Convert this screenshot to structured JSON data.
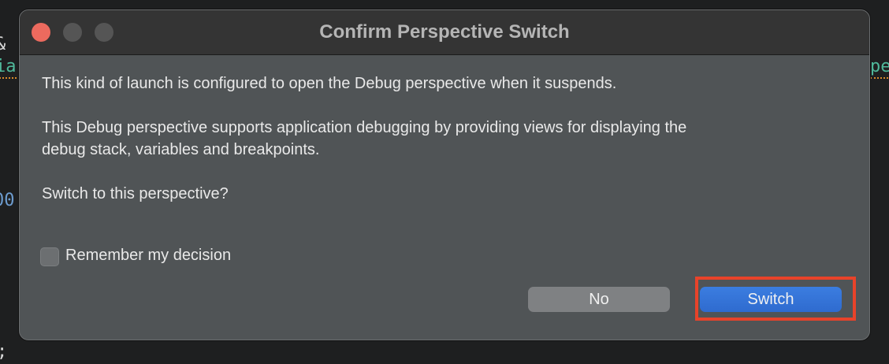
{
  "background_code": {
    "frag1": "&",
    "frag2": "ia",
    "frag3": "00",
    "frag4": ";",
    "frag5": "pe"
  },
  "dialog": {
    "title": "Confirm Perspective Switch",
    "message1": "This kind of launch is configured to open the Debug perspective when it suspends.",
    "message2_line1": "This Debug perspective supports application debugging by providing views for displaying the",
    "message2_line2": "debug stack, variables and breakpoints.",
    "question": "Switch to this perspective?",
    "remember_label": "Remember my decision",
    "remember_checked": false,
    "no_label": "No",
    "switch_label": "Switch"
  },
  "colors": {
    "accent": "#2f6fd6",
    "highlight": "#e8432a",
    "close": "#ec6a5e"
  }
}
